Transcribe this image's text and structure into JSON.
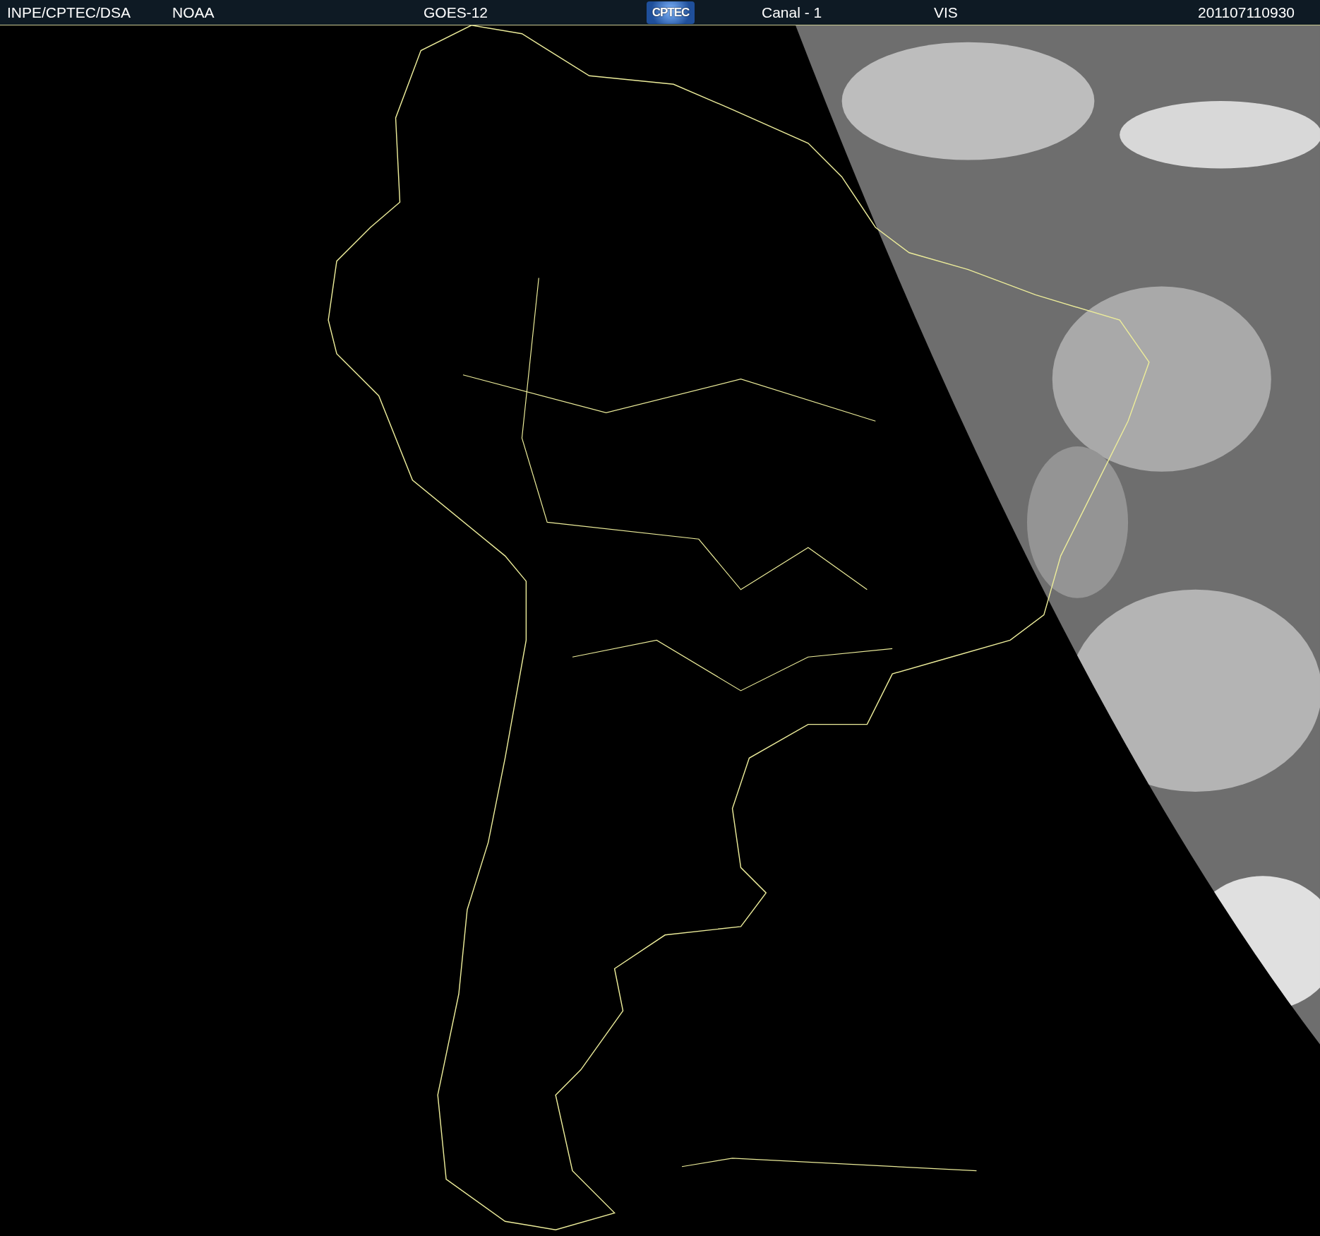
{
  "header": {
    "items": [
      {
        "kind": "text",
        "text": "INPE/CPTEC/DSA"
      },
      {
        "kind": "text",
        "text": "NOAA"
      },
      {
        "kind": "text",
        "text": "GOES-12"
      },
      {
        "kind": "logo",
        "text": "CPTEC"
      },
      {
        "kind": "text",
        "text": "Canal - 1"
      },
      {
        "kind": "text",
        "text": "VIS"
      },
      {
        "kind": "date",
        "text": "201107110930"
      }
    ]
  }
}
